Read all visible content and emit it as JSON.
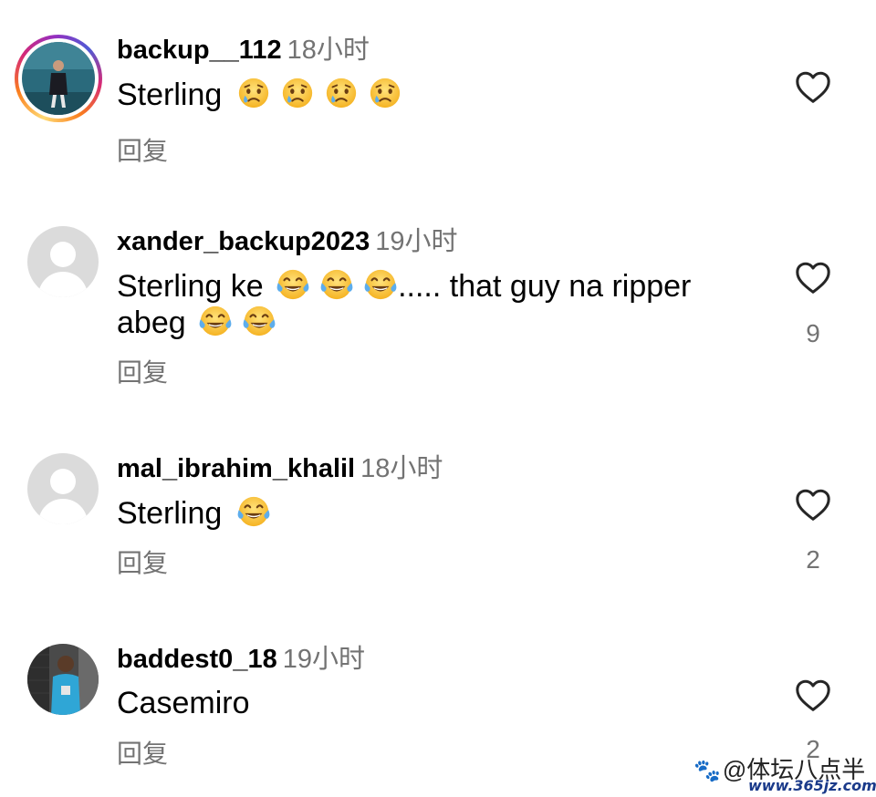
{
  "comments": [
    {
      "username": "backup__112",
      "time": "18小时",
      "text": "Sterling",
      "emojis": [
        "crying-face",
        "crying-face",
        "crying-face",
        "crying-face"
      ],
      "reply_label": "回复",
      "likes": "",
      "avatar": "story-ring-photo"
    },
    {
      "username": "xander_backup2023",
      "time": "19小时",
      "text_before": "Sterling ke",
      "text_after": "..... that guy na ripper",
      "text_line2": "abeg",
      "emojis": [
        "tears-of-joy",
        "tears-of-joy",
        "tears-of-joy"
      ],
      "emojis_line2": [
        "tears-of-joy",
        "tears-of-joy"
      ],
      "reply_label": "回复",
      "likes": "9",
      "avatar": "default"
    },
    {
      "username": "mal_ibrahim_khalil",
      "time": "18小时",
      "text": "Sterling",
      "emojis": [
        "tears-of-joy"
      ],
      "reply_label": "回复",
      "likes": "2",
      "avatar": "default"
    },
    {
      "username": "baddest0_18",
      "time": "19小时",
      "text": "Casemiro",
      "reply_label": "回复",
      "likes": "2",
      "avatar": "photo"
    }
  ],
  "watermark": {
    "text": "@体坛八点半",
    "url": "www.365jz.com"
  },
  "colors": {
    "meta_gray": "#737373",
    "emoji_yellow": "#ffcc4d",
    "tear_blue": "#5dadec"
  }
}
